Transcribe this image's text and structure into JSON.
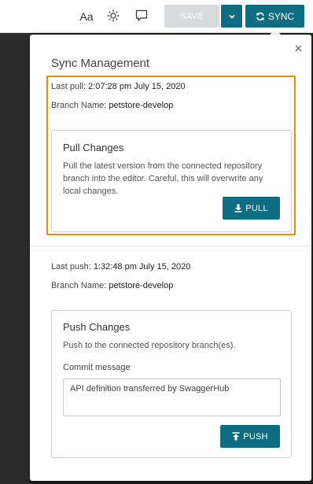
{
  "toolbar": {
    "font_label": "Aa",
    "save_label": "SAVE",
    "sync_label": "SYNC",
    "icons": [
      "font-size-icon",
      "theme-icon",
      "comment-icon",
      "chevron-down-icon",
      "sync-icon"
    ]
  },
  "panel": {
    "title": "Sync Management",
    "close_icon": "close-icon"
  },
  "pull": {
    "last_label": "Last pull:",
    "last_value": "2:07:28 pm July 15, 2020",
    "branch_label": "Branch Name:",
    "branch_value": "petstore-develop",
    "card_title": "Pull Changes",
    "card_desc": "Pull the latest version from the connected repository branch into the editor. Careful, this will overwrite any local changes.",
    "button_label": "PULL"
  },
  "push": {
    "last_label": "Last push:",
    "last_value": "1:32:48 pm July 15, 2020",
    "branch_label": "Branch Name:",
    "branch_value": "petstore-develop",
    "card_title": "Push Changes",
    "card_desc": "Push to the connected repository branch(es).",
    "commit_label": "Commit message",
    "commit_value": "API definition transferred by SwaggerHub",
    "button_label": "PUSH"
  },
  "colors": {
    "accent": "#0e6d80",
    "highlight": "#f08a00",
    "disabled": "#d7dbde"
  }
}
